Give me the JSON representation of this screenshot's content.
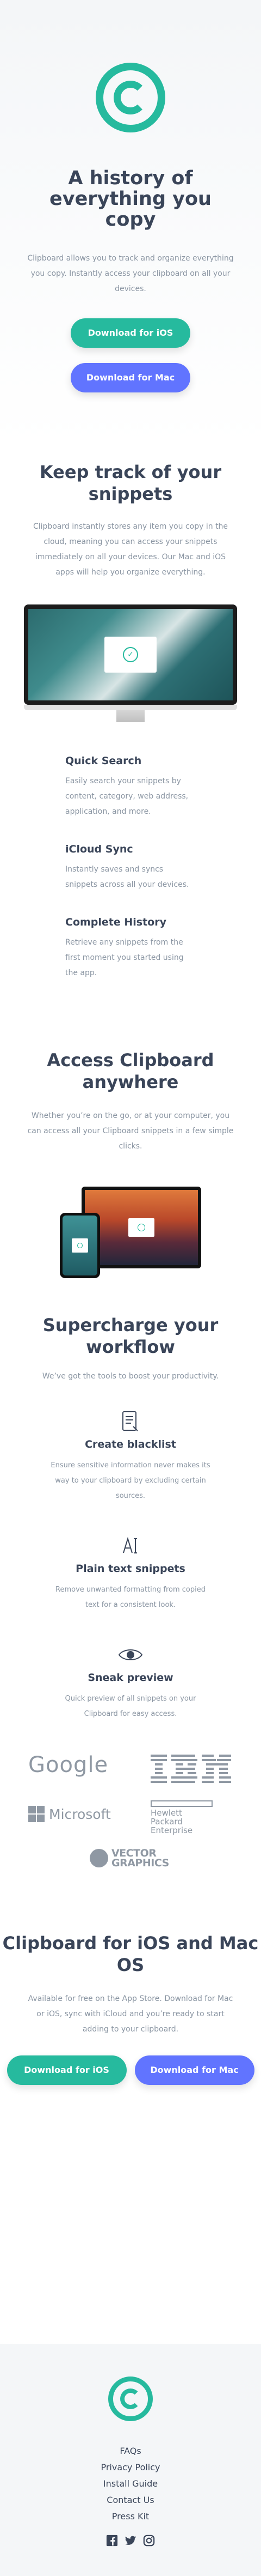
{
  "hero": {
    "title": "A history of everything you copy",
    "subtitle": "Clipboard allows you to track and organize everything you copy. Instantly access your clipboard on all your devices.",
    "ios_button": "Download for iOS",
    "mac_button": "Download for Mac"
  },
  "track": {
    "title": "Keep track of your snippets",
    "description": "Clipboard instantly stores any item you copy in the cloud, meaning you can access your snippets immediately on all your devices. Our Mac and iOS apps will help you organize everything.",
    "features": [
      {
        "title": "Quick Search",
        "text": "Easily search your snippets by content, category, web address, application, and more."
      },
      {
        "title": "iCloud Sync",
        "text": "Instantly saves and syncs snippets across all your devices."
      },
      {
        "title": "Complete History",
        "text": "Retrieve any snippets from the first moment you started using the app."
      }
    ]
  },
  "access": {
    "title": "Access Clipboard anywhere",
    "description": "Whether you’re on the go, or at your computer, you can access all your Clipboard snippets in a few simple clicks."
  },
  "workflow": {
    "title": "Supercharge your workflow",
    "description": "We’ve got the tools to boost your productivity.",
    "items": [
      {
        "title": "Create blacklist",
        "text": "Ensure sensitive information never makes its way to your clipboard by excluding certain sources."
      },
      {
        "title": "Plain text snippets",
        "text": "Remove unwanted formatting from copied text for a consistent look."
      },
      {
        "title": "Sneak preview",
        "text": "Quick preview of all snippets on your Clipboard for easy access."
      }
    ]
  },
  "partners": {
    "google": "Google",
    "ibm": "IBM",
    "microsoft": "Microsoft",
    "hp": "Hewlett Packard Enterprise",
    "vector": "VECTOR GRAPHICS"
  },
  "cta": {
    "title": "Clipboard for iOS and Mac OS",
    "description": "Available for free on the App Store. Download for Mac or iOS, sync with iCloud and you’re ready to start adding to your clipboard.",
    "ios_button": "Download for iOS",
    "mac_button": "Download for Mac"
  },
  "footer": {
    "links": [
      "FAQs",
      "Privacy Policy",
      "Install Guide",
      "Contact Us",
      "Press Kit"
    ],
    "social_icons": [
      "facebook-icon",
      "twitter-icon",
      "instagram-icon"
    ]
  },
  "colors": {
    "accent_teal": "#26ba9e",
    "accent_blue": "#6174ff",
    "heading": "#3a4559",
    "body_text": "#8b96a3"
  }
}
